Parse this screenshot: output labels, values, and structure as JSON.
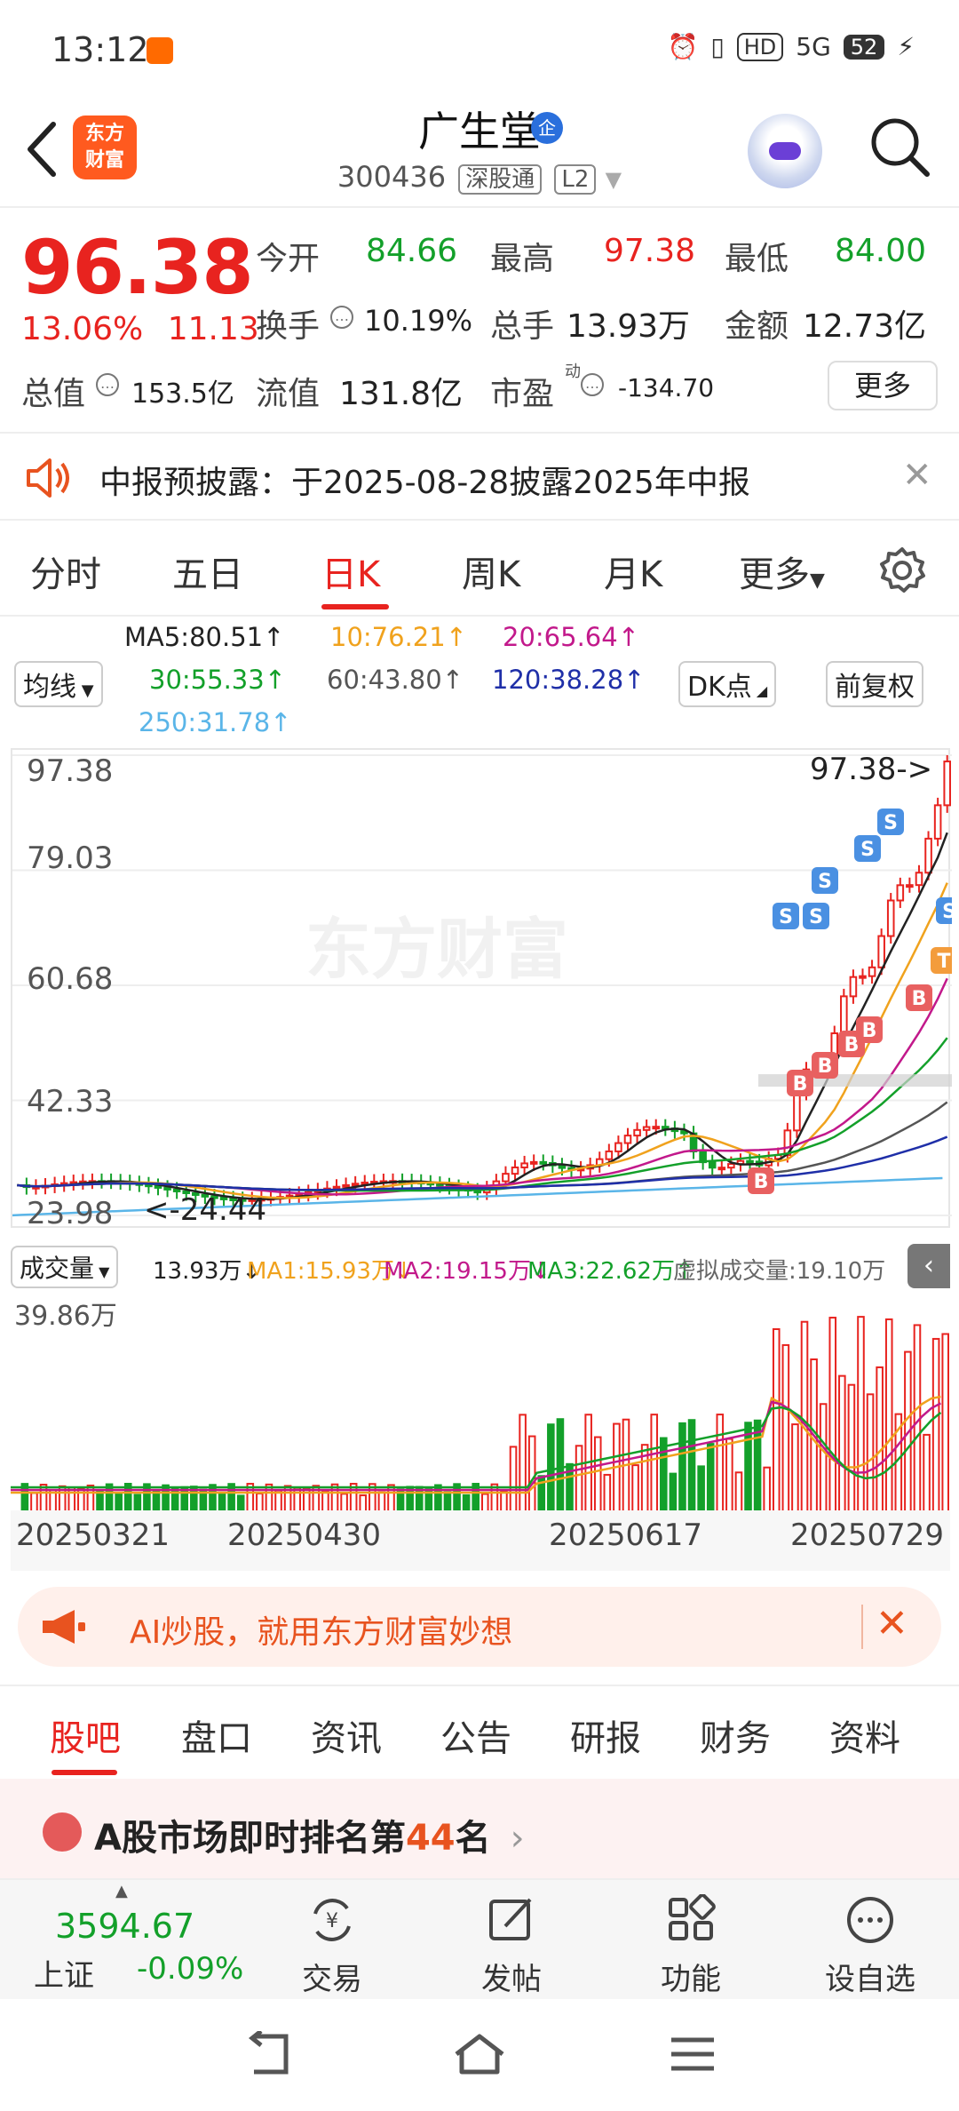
{
  "status_bar": {
    "time": "13:12",
    "signal": "5G",
    "hd": "HD",
    "battery": "52"
  },
  "header": {
    "app_logo_line1": "东方",
    "app_logo_line2": "财富",
    "stock_name": "广生堂",
    "badge": "企",
    "stock_code": "300436",
    "tag_market": "深股通",
    "tag_level": "L2"
  },
  "quote": {
    "price": "96.38",
    "change_pct": "13.06%",
    "change_abs": "11.13",
    "open_label": "今开",
    "open_value": "84.66",
    "high_label": "最高",
    "high_value": "97.38",
    "low_label": "最低",
    "low_value": "84.00",
    "turnover_label": "换手",
    "turnover_value": "10.19%",
    "volume_label": "总手",
    "volume_value": "13.93万",
    "amount_label": "金额",
    "amount_value": "12.73亿",
    "mktcap_label": "总值",
    "mktcap_value": "153.5亿",
    "float_label": "流值",
    "float_value": "131.8亿",
    "pe_label": "市盈",
    "pe_sup": "动",
    "pe_value": "-134.70",
    "more_button": "更多"
  },
  "notice": {
    "text": "中报预披露：于2025-08-28披露2025年中报"
  },
  "chart_tabs": [
    "分时",
    "五日",
    "日K",
    "周K",
    "月K",
    "更多"
  ],
  "ma_legend": {
    "ma5": "MA5:80.51↑",
    "ma10": "10:76.21↑",
    "ma20": "20:65.64↑",
    "ma30": "30:55.33↑",
    "ma60": "60:43.80↑",
    "ma120": "120:38.28↑",
    "ma250": "250:31.78↑",
    "select_label": "均线",
    "dk_label": "DK点",
    "adjust_label": "前复权"
  },
  "kchart": {
    "y_labels": [
      "97.38",
      "79.03",
      "60.68",
      "42.33",
      "23.98"
    ],
    "high_marker": "97.38->",
    "low_marker": "<-24.44",
    "watermark": "东方财富",
    "signal_s": "S",
    "signal_b": "B",
    "signal_t": "T"
  },
  "volume": {
    "selector": "成交量",
    "vol_value": "13.93万↓",
    "ma1": "MA1:15.93万↓",
    "ma2": "MA2:19.15万↓",
    "ma3": "MA3:22.62万↑",
    "virtual": "虚拟成交量:19.10万",
    "y_label": "39.86万"
  },
  "dates": [
    "20250321",
    "20250430",
    "20250617",
    "20250729"
  ],
  "ai_banner": {
    "text": "AI炒股，就用东方财富妙想"
  },
  "bottom_tabs": [
    "股吧",
    "盘口",
    "资讯",
    "公告",
    "研报",
    "财务",
    "资料"
  ],
  "rank": {
    "prefix": "A股市场即时排名第",
    "number": "44",
    "suffix": "名"
  },
  "bottom_nav": {
    "index_value": "3594.67",
    "index_name": "上证",
    "index_change": "-0.09%",
    "trade": "交易",
    "post": "发帖",
    "functions": "功能",
    "add_watch": "设自选"
  },
  "colors": {
    "up": "#e8231f",
    "down": "#13a02a",
    "accent": "#ff5a1f"
  }
}
